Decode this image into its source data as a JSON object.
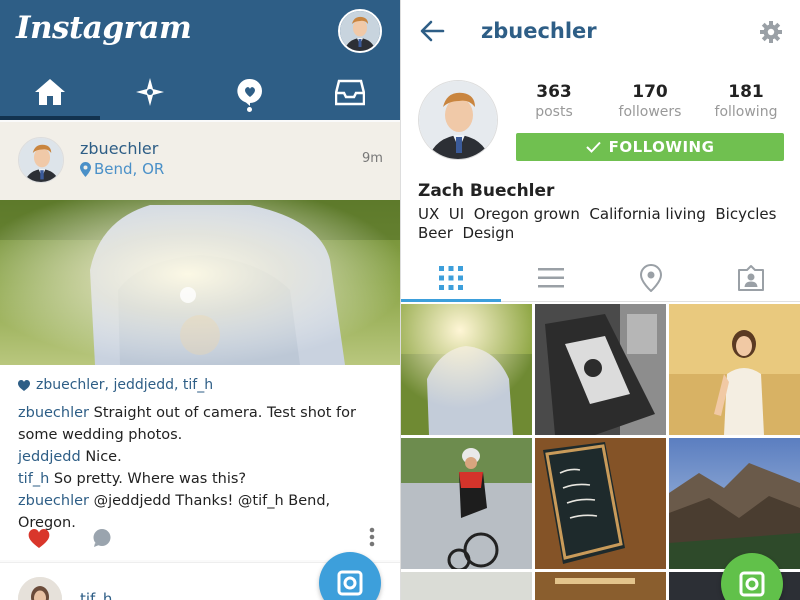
{
  "feed": {
    "app_title": "Instagram",
    "tabs": [
      {
        "name": "home",
        "icon": "home-icon"
      },
      {
        "name": "explore",
        "icon": "explore-icon"
      },
      {
        "name": "news",
        "icon": "news-icon"
      },
      {
        "name": "inbox",
        "icon": "inbox-icon"
      }
    ],
    "post": {
      "username": "zbuechler",
      "location": "Bend, OR",
      "time": "9m",
      "likes": "zbuechler, jeddjedd, tif_h",
      "comments": [
        {
          "user": "zbuechler",
          "text": "Straight out of camera. Test shot for some wedding photos."
        },
        {
          "user": "jeddjedd",
          "text": "Nice."
        },
        {
          "user": "tif_h",
          "text": "So pretty. Where was this?"
        },
        {
          "user": "zbuechler",
          "text": "@jeddjedd Thanks! @tif_h Bend, Oregon."
        }
      ]
    },
    "next_post": {
      "username": "tif_h"
    }
  },
  "profile": {
    "username": "zbuechler",
    "stats": [
      {
        "value": "363",
        "label": "posts"
      },
      {
        "value": "170",
        "label": "followers"
      },
      {
        "value": "181",
        "label": "following"
      }
    ],
    "follow_label": "FOLLOWING",
    "full_name": "Zach Buechler",
    "bio": "UX  UI  Oregon grown  California living  Bicycles  Beer  Design"
  },
  "colors": {
    "brand_blue": "#2e5e86",
    "link_blue": "#4a90c8",
    "accent_blue": "#3d9fdb",
    "follow_green": "#70c050",
    "like_red": "#d9362b"
  }
}
